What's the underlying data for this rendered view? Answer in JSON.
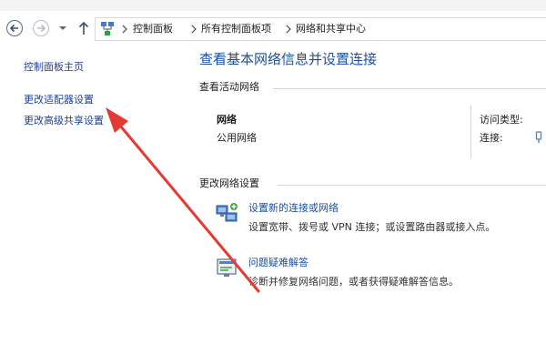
{
  "breadcrumb": {
    "items": [
      "控制面板",
      "所有控制面板项",
      "网络和共享中心"
    ]
  },
  "sidebar": {
    "items": [
      {
        "label": "控制面板主页"
      },
      {
        "label": "更改适配器设置"
      },
      {
        "label": "更改高级共享设置"
      }
    ]
  },
  "main": {
    "title": "查看基本网络信息并设置连接",
    "active_networks": {
      "section_title": "查看活动网络",
      "network_name": "网络",
      "network_type": "公用网络",
      "access_type_label": "访问类型:",
      "connections_label": "连接:"
    },
    "change_settings": {
      "section_title": "更改网络设置",
      "tasks": [
        {
          "link": "设置新的连接或网络",
          "description": "设置宽带、拨号或 VPN 连接；或设置路由器或接入点。",
          "icon": "network-setup-icon"
        },
        {
          "link": "问题疑难解答",
          "description": "诊断并修复网络问题，或者获得疑难解答信息。",
          "icon": "troubleshoot-icon"
        }
      ]
    }
  },
  "colors": {
    "link": "#1e3f99",
    "title": "#1b4fa0",
    "annotation_arrow": "#e53935"
  }
}
